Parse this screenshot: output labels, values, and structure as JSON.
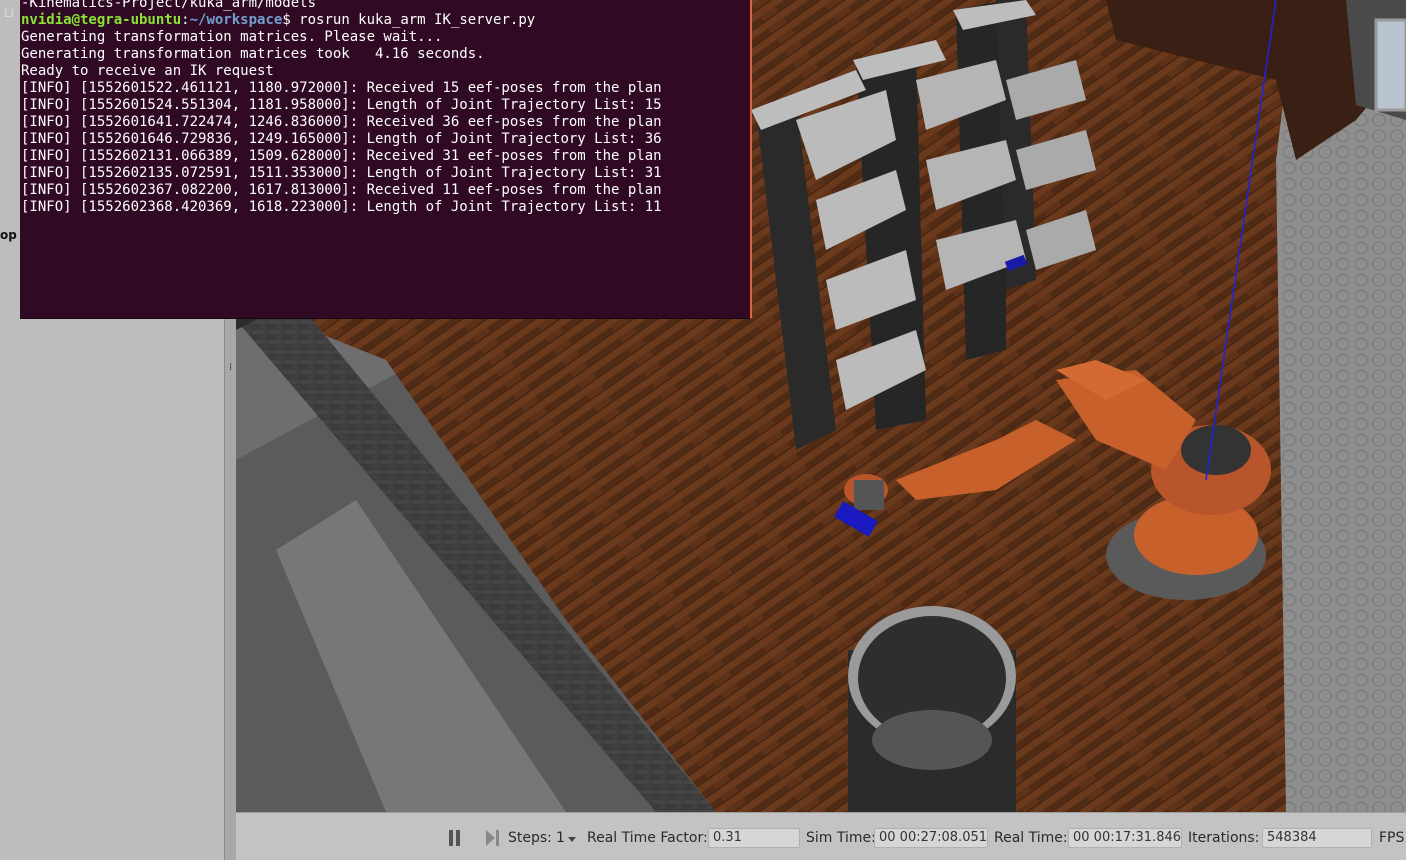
{
  "left_panel": {
    "top_label": "Li",
    "tab_label": "op",
    "grip": "⁞"
  },
  "terminal": {
    "lines": [
      "-Kinematics-Project/kuka_arm/models",
      "Generating transformation matrices. Please wait...",
      "Generating transformation matrices took   4.16 seconds.",
      "Ready to receive an IK request",
      "[INFO] [1552601522.461121, 1180.972000]: Received 15 eef-poses from the plan",
      "[INFO] [1552601524.551304, 1181.958000]: Length of Joint Trajectory List: 15",
      "[INFO] [1552601641.722474, 1246.836000]: Received 36 eef-poses from the plan",
      "[INFO] [1552601646.729836, 1249.165000]: Length of Joint Trajectory List: 36",
      "[INFO] [1552602131.066389, 1509.628000]: Received 31 eef-poses from the plan",
      "[INFO] [1552602135.072591, 1511.353000]: Length of Joint Trajectory List: 31",
      "[INFO] [1552602367.082200, 1617.813000]: Received 11 eef-poses from the plan",
      "[INFO] [1552602368.420369, 1618.223000]: Length of Joint Trajectory List: 11"
    ],
    "prompt": {
      "user_host": "nvidia@tegra-ubuntu",
      "sep": ":",
      "path": "~/workspace",
      "symbol": "$ ",
      "command": "rosrun kuka_arm IK_server.py"
    }
  },
  "statusbar": {
    "steps_label": "Steps:",
    "steps_value": "1",
    "rtf_label": "Real Time Factor:",
    "rtf_value": "0.31",
    "sim_time_label": "Sim Time:",
    "sim_time_value": "00 00:27:08.051",
    "real_time_label": "Real Time:",
    "real_time_value": "00 00:17:31.846",
    "iterations_label": "Iterations:",
    "iterations_value": "548384",
    "fps_label": "FPS:"
  },
  "colors": {
    "terminal_bg": "#300a24",
    "terminal_border": "#e2643a",
    "prompt_user": "#8ae234",
    "prompt_path": "#729fcf",
    "robot_orange": "#c8602c",
    "floor_wood": "#5e3218"
  },
  "icons": [
    "pause-icon",
    "step-icon",
    "dropdown-arrow-icon",
    "grip-icon"
  ]
}
